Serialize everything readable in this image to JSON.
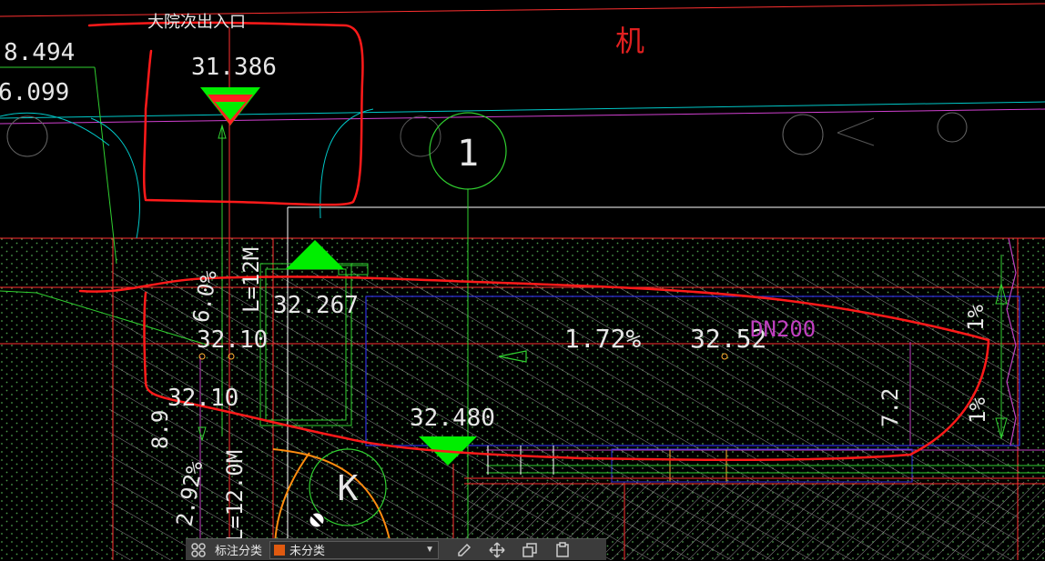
{
  "drawing": {
    "labels": {
      "entrance_note": "大院次出入口",
      "room_mark": "机",
      "level_left_top": "8.494",
      "level_left_second": "6.099",
      "elev_marker_top": "31.386",
      "axis_bubble": "1",
      "elev_marker_mid": "32.267",
      "slope_left_upper": "6.0%",
      "length_upper": "L=12M",
      "elev_3210_a": "32.10",
      "elev_3210_b": "32.10",
      "slope_mid": "1.72%",
      "elev_3252": "32.52",
      "pipe": "DN200",
      "slope_right_a": "1%",
      "slope_right_b": "1%",
      "dim_72": "7.2",
      "elev_marker_bottom": "32.480",
      "dim_89": "8.9",
      "slope_left_lower": "2.92%",
      "length_lower": "L=12.0M",
      "kbubble": "K"
    },
    "colors": {
      "background": "#000000",
      "annotation": "#ff1a1a",
      "marker": "#00ee00",
      "text": "#e6e6e6",
      "pipe_label": "#c040c0"
    }
  },
  "toolbar": {
    "category_label": "标注分类",
    "category_value": "未分类",
    "category_color": "#e05a10",
    "tools": [
      "edit-icon",
      "move-icon",
      "copy-icon",
      "paste-icon"
    ]
  }
}
